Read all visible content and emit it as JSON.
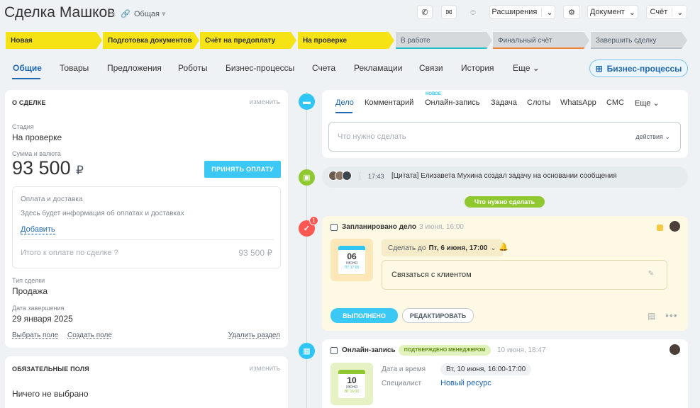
{
  "header": {
    "title": "Сделка Машков",
    "category": "Общая",
    "extensions_label": "Расширения",
    "document_label": "Документ",
    "invoice_label": "Счёт"
  },
  "stages": [
    {
      "label": "Новая",
      "state": "done"
    },
    {
      "label": "Подготовка документов",
      "state": "done"
    },
    {
      "label": "Счёт на предоплату",
      "state": "done"
    },
    {
      "label": "На проверке",
      "state": "current"
    },
    {
      "label": "В работе",
      "state": "todo",
      "color": "#27c1c9"
    },
    {
      "label": "Финальный счёт",
      "state": "todo",
      "color": "#ef8537"
    },
    {
      "label": "Завершить сделку",
      "state": "todo",
      "color": "#b9c0c6"
    }
  ],
  "tabs": [
    "Общие",
    "Товары",
    "Предложения",
    "Роботы",
    "Бизнес-процессы",
    "Счета",
    "Рекламации",
    "Связи",
    "История",
    "Еще"
  ],
  "bp_button": "Бизнес-процессы",
  "about": {
    "title": "О СДЕЛКЕ",
    "edit": "изменить",
    "stage_label": "Стадия",
    "stage_value": "На проверке",
    "sum_label": "Сумма и валюта",
    "sum_value": "93 500",
    "currency": "₽",
    "pay_button": "ПРИНЯТЬ ОПЛАТУ",
    "payment": {
      "title": "Оплата и доставка",
      "placeholder": "Здесь будет информация об оплатах и доставках",
      "add": "Добавить",
      "total_label": "Итого к оплате по сделке",
      "total_value": "93 500 ₽"
    },
    "type_label": "Тип сделки",
    "type_value": "Продажа",
    "close_label": "Дата завершения",
    "close_value": "29 января 2025",
    "select_field": "Выбрать поле",
    "create_field": "Создать поле",
    "delete_section": "Удалить раздел"
  },
  "required": {
    "title": "ОБЯЗАТЕЛЬНЫЕ ПОЛЯ",
    "edit": "изменить",
    "empty": "Ничего не выбрано"
  },
  "composer": {
    "tabs": [
      "Дело",
      "Комментарий",
      "Онлайн-запись",
      "Задача",
      "Слоты",
      "WhatsApp",
      "СМС",
      "Еще"
    ],
    "new_badge": "НОВОЕ",
    "placeholder": "Что нужно сделать",
    "actions": "действия"
  },
  "feed_item": {
    "time": "17:43",
    "text": "[Цитата] Елизавета Мухина создал задачу на основании сообщения"
  },
  "todo_divider": "Что нужно сделать",
  "activity1": {
    "badge_count": "1",
    "title": "Запланировано дело",
    "date": "3 июня, 16:00",
    "cal_day": "06",
    "cal_month": "ИЮНЯ",
    "cal_time": "ПТ 17:00",
    "deadline_prefix": "Сделать до",
    "deadline": "Пт, 6 июня, 17:00",
    "text": "Связаться с клиентом",
    "done_button": "ВЫПОЛНЕНО",
    "edit_button": "РЕДАКТИРОВАТЬ"
  },
  "activity2": {
    "title": "Онлайн-запись",
    "status": "ПОДТВЕРЖДЕНО МЕНЕДЖЕРОМ",
    "date": "10 июня, 18:47",
    "cal_day": "10",
    "cal_month": "ИЮНЯ",
    "cal_time": "ВТ 16:00",
    "datetime_label": "Дата и время",
    "datetime_value": "Вт, 10 июня, 16:00-17:00",
    "specialist_label": "Специалист",
    "specialist_value": "Новый ресурс"
  },
  "colors": {
    "stage_done": "#f6e316",
    "accent_blue": "#2067b0",
    "pay_button": "#3bc8f5",
    "timeline_green": "#8fc92f",
    "alert_red": "#ff5752"
  },
  "icons": [
    "pencil-icon",
    "link-icon",
    "phone-icon",
    "mail-icon",
    "chat-icon",
    "gear-icon",
    "chevron-down-icon",
    "comment-icon",
    "check-icon",
    "bell-icon",
    "calendar-icon",
    "note-icon",
    "more-icon"
  ]
}
